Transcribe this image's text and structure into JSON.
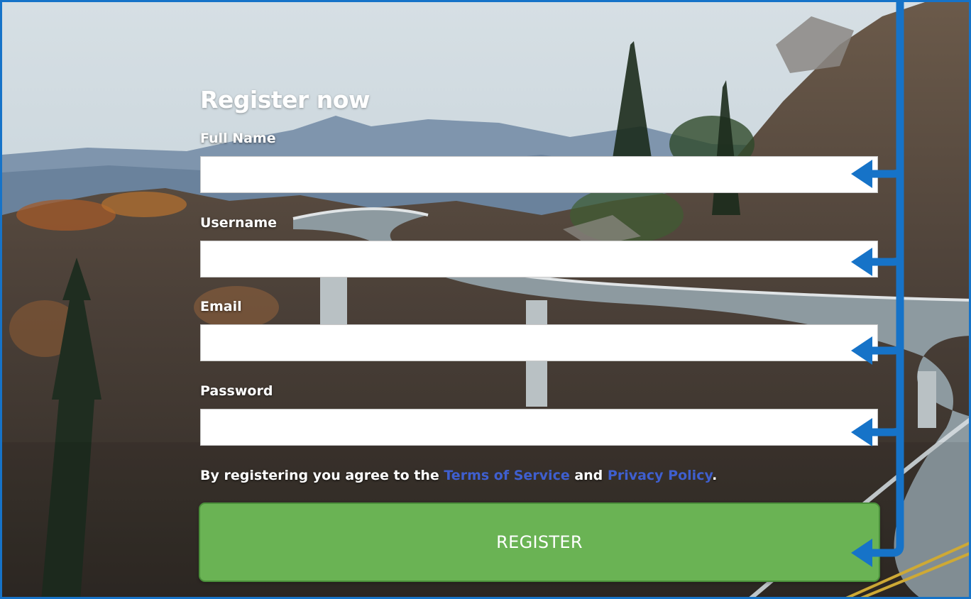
{
  "form": {
    "title": "Register now",
    "fields": [
      {
        "label": "Full Name",
        "value": ""
      },
      {
        "label": "Username",
        "value": ""
      },
      {
        "label": "Email",
        "value": ""
      },
      {
        "label": "Password",
        "value": ""
      }
    ],
    "agreement": {
      "prefix": "By registering you agree to the ",
      "terms_link": "Terms of Service",
      "conjunction": " and ",
      "privacy_link": "Privacy Policy",
      "suffix": "."
    },
    "submit_label": "REGISTER"
  },
  "colors": {
    "annotation_blue": "#1673c8",
    "register_green": "#6ab354",
    "link_blue": "#3f5fcf"
  },
  "icons": [
    "annotation-arrow-icon"
  ]
}
